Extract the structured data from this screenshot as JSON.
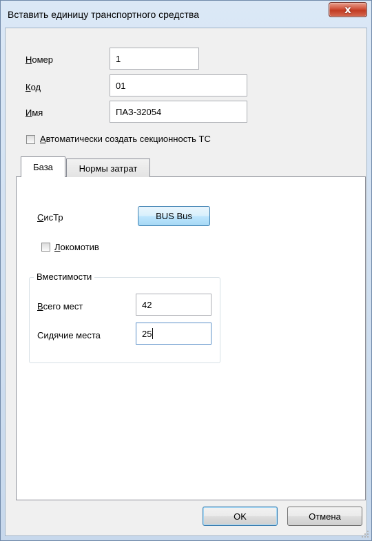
{
  "window": {
    "title": "Вставить единицу транспортного средства",
    "close_glyph": "x"
  },
  "fields": {
    "number": {
      "label": "Номер",
      "accel": "Н",
      "rest": "омер",
      "value": "1"
    },
    "code": {
      "label": "Код",
      "accel": "К",
      "rest": "од",
      "value": "01"
    },
    "name": {
      "label": "Имя",
      "accel": "И",
      "rest": "мя",
      "value": "ПАЗ-32054"
    }
  },
  "auto_sections": {
    "label": "Автоматически создать секционность ТС",
    "accel": "А",
    "rest": "втоматически создать секционность ТС",
    "checked": false
  },
  "tabs": [
    {
      "label": "База",
      "active": true
    },
    {
      "label": "Нормы затрат",
      "active": false
    }
  ],
  "base_tab": {
    "systr": {
      "label": "СисТр",
      "accel": "С",
      "rest": "исТр",
      "button": "BUS Bus"
    },
    "locomotive": {
      "label": "Локомотив",
      "accel": "Л",
      "rest": "окомотив",
      "checked": false
    },
    "capacity": {
      "title": "Вместимости",
      "total": {
        "label": "Всего мест",
        "accel": "В",
        "rest": "сего мест",
        "value": "42"
      },
      "seated": {
        "label": "Сидячие места",
        "pre": "Си",
        "accel": "д",
        "rest": "ячие места",
        "value": "25"
      }
    }
  },
  "buttons": {
    "ok": "OK",
    "cancel": "Отмена"
  },
  "colors": {
    "close_red": "#c7432b",
    "focus_blue": "#3c7fb1",
    "frame_blue": "#dbe8f6"
  },
  "icons": {
    "close": "close-icon",
    "size_grip": "size-grip-icon"
  }
}
